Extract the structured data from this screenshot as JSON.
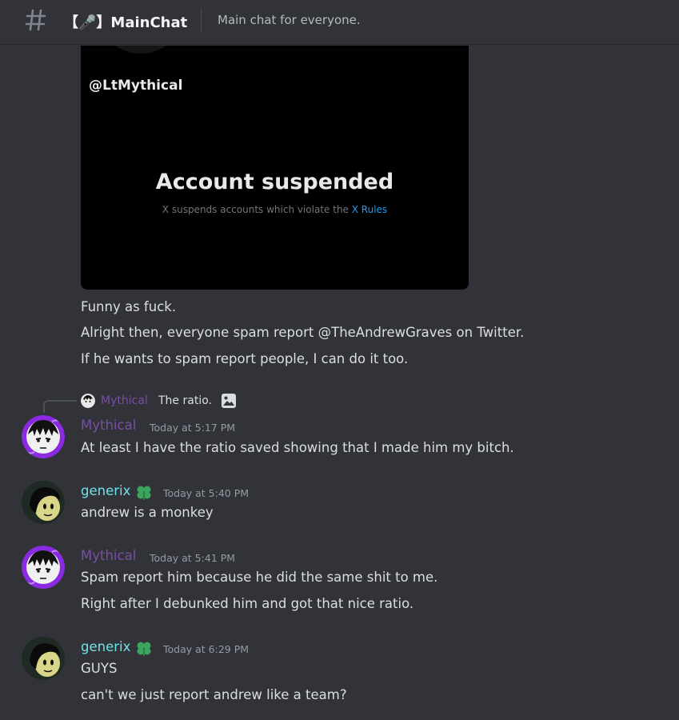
{
  "header": {
    "channel_name": "【🎤】MainChat",
    "topic": "Main chat for everyone."
  },
  "embed": {
    "handle": "@LtMythical",
    "title": "Account suspended",
    "subtitle": "X suspends accounts which violate the",
    "subtitle_link": "X Rules"
  },
  "messages_top": [
    "Funny as fuck.",
    "Alright then, everyone spam report @TheAndrewGraves on Twitter.",
    "If he wants to spam report people, I can do it too."
  ],
  "reply": {
    "name": "Mythical",
    "text": "The ratio."
  },
  "groups": [
    {
      "author": "Mythical",
      "timestamp": "Today at 5:17 PM",
      "lines": [
        "At least I have the ratio saved showing that I made him my bitch."
      ]
    },
    {
      "author": "generix",
      "timestamp": "Today at 5:40 PM",
      "lines": [
        "andrew is a monkey"
      ]
    },
    {
      "author": "Mythical",
      "timestamp": "Today at 5:41 PM",
      "lines": [
        "Spam report him because he did the same shit to me.",
        "Right after I debunked him and got that nice ratio."
      ]
    },
    {
      "author": "generix",
      "timestamp": "Today at 6:29 PM",
      "lines": [
        "GUYS",
        "can't we just report andrew like a team?"
      ]
    }
  ],
  "colors": {
    "background": "#313338",
    "mythical_name": "#7b4ea6",
    "generix_name": "#6ee3e8",
    "badge": "#3ba55d",
    "link": "#1d9bf0"
  },
  "icons": {
    "channel": "hash-icon",
    "reply_attachment": "image-icon",
    "role_badge": "clover-badge-icon"
  }
}
